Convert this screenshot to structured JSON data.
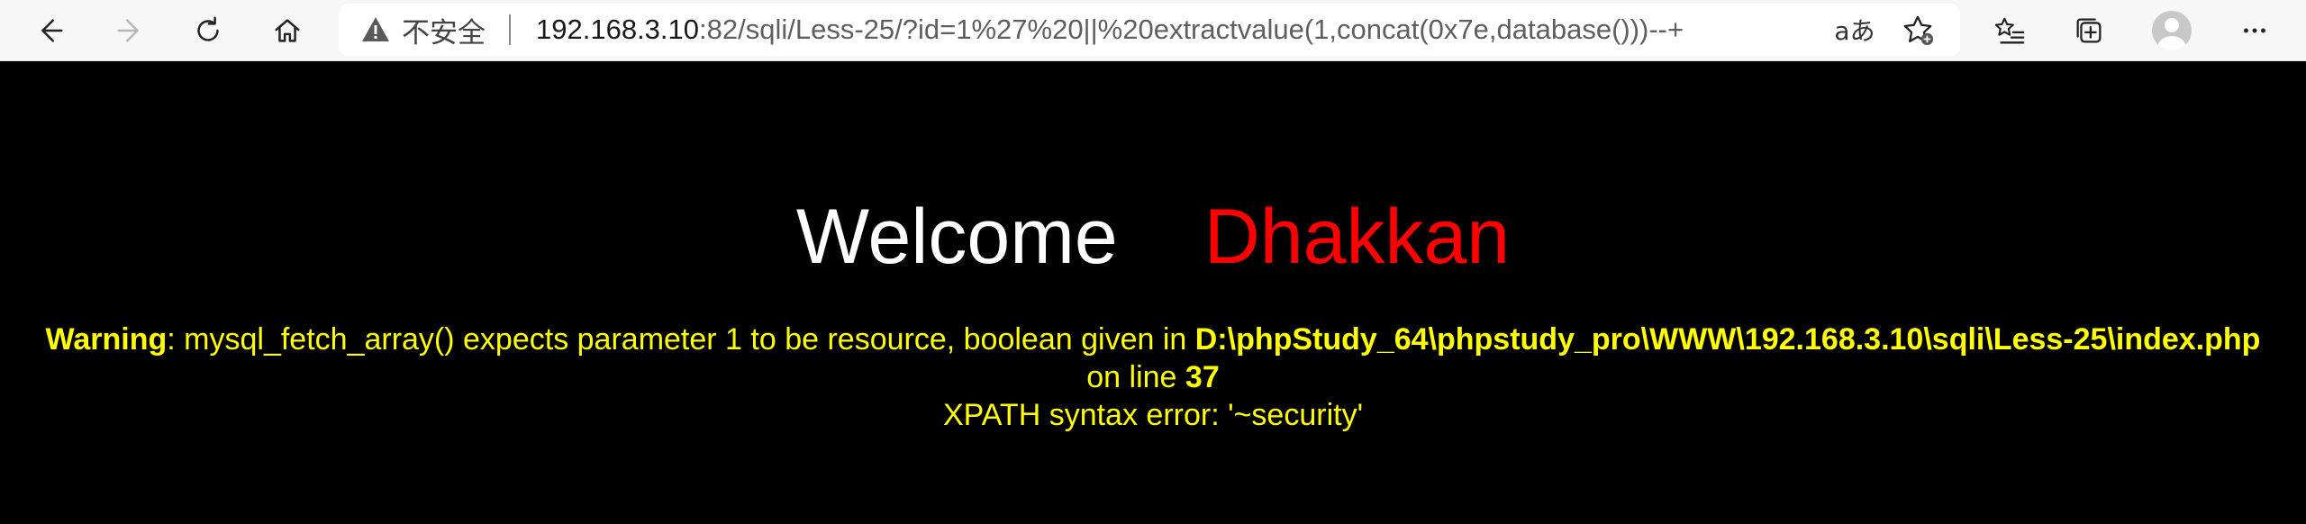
{
  "browser": {
    "security_label": "不安全",
    "url_host": "192.168.3.10",
    "url_rest": ":82/sqli/Less-25/?id=1%27%20||%20extractvalue(1,concat(0x7e,database()))--+",
    "read_aloud_label": "aあ",
    "icons": {
      "back": "back-arrow-icon",
      "forward": "forward-arrow-icon",
      "refresh": "refresh-icon",
      "home": "home-icon",
      "warning": "warning-triangle-icon",
      "favorite_add": "add-favorite-icon",
      "favorites": "favorites-list-icon",
      "collections": "collections-icon",
      "profile": "profile-avatar-icon",
      "menu": "more-menu-icon"
    }
  },
  "page": {
    "welcome_text": "Welcome",
    "username": "Dhakkan",
    "warning_label": "Warning",
    "warning_message": ": mysql_fetch_array() expects parameter 1 to be resource, boolean given in ",
    "warning_path": "D:\\phpStudy_64\\phpstudy_pro\\WWW\\192.168.3.10\\sqli\\Less-25\\index.php",
    "on_line_text": "on line ",
    "line_number": "37",
    "xpath_error": "XPATH syntax error: '~security'"
  },
  "colors": {
    "background": "#000000",
    "welcome": "#ffffff",
    "username": "#ff0000",
    "message": "#ffff00"
  }
}
